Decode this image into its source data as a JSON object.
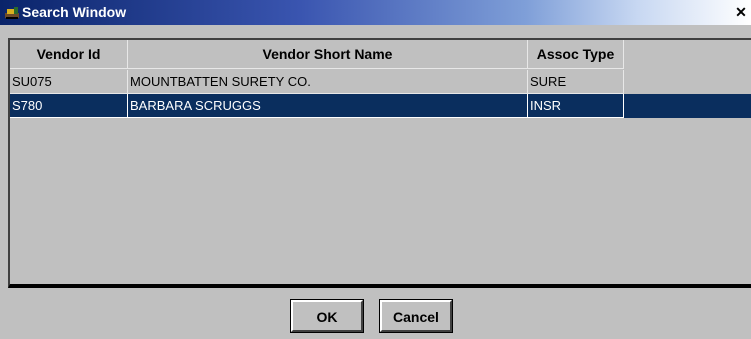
{
  "window": {
    "title": "Search Window",
    "close_label": "✕"
  },
  "table": {
    "columns": [
      "Vendor Id",
      "Vendor Short Name",
      "Assoc Type"
    ],
    "rows": [
      {
        "vendor_id": "SU075",
        "name": "MOUNTBATTEN SURETY CO.",
        "assoc_type": "SURE",
        "selected": false
      },
      {
        "vendor_id": "S780",
        "name": "BARBARA SCRUGGS",
        "assoc_type": "INSR",
        "selected": true
      }
    ]
  },
  "buttons": {
    "ok": "OK",
    "cancel": "Cancel"
  },
  "colors": {
    "selection": "#0a2e5e",
    "face": "#c0c0c0"
  }
}
